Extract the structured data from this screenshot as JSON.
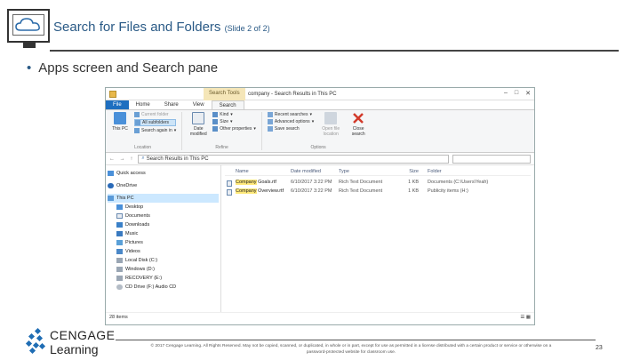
{
  "slide": {
    "title": "Search for Files and Folders",
    "subtitle": "(Slide 2 of 2)",
    "bullet": "Apps screen and Search pane",
    "page_number": "23",
    "copyright_line1": "© 2017 Cengage Learning. All Rights Reserved. May not be copied, scanned, or duplicated, in whole or in part, except for use as permitted in a license distributed with a certain product or service or otherwise on a",
    "copyright_line2": "password-protected website for classroom use.",
    "brand": "CENGAGE",
    "brand_sub": "Learning"
  },
  "window": {
    "context_tab": "Search Tools",
    "title": "company - Search Results in This PC",
    "controls": [
      "–",
      "□",
      "✕"
    ],
    "tabs": [
      "File",
      "Home",
      "Share",
      "View",
      "Search"
    ],
    "ribbon": {
      "location": {
        "label": "Location",
        "this_pc": "This PC",
        "current_folder": "Current folder",
        "all_subfolders": "All subfolders",
        "search_again": "Search again in"
      },
      "refine": {
        "label": "Refine",
        "date_modified": "Date modified",
        "kind": "Kind",
        "size": "Size",
        "other_properties": "Other properties"
      },
      "options": {
        "label": "Options",
        "recent_searches": "Recent searches",
        "advanced_options": "Advanced options",
        "save_search": "Save search",
        "open_file_location": "Open file location",
        "close_search": "Close search"
      }
    },
    "address": "Search Results in This PC",
    "nav": {
      "quick_access": "Quick access",
      "onedrive": "OneDrive",
      "this_pc": "This PC",
      "desktop": "Desktop",
      "documents": "Documents",
      "downloads": "Downloads",
      "music": "Music",
      "pictures": "Pictures",
      "videos": "Videos",
      "local_disk": "Local Disk (C:)",
      "windows": "Windows (D:)",
      "recovery": "RECOVERY (E:)",
      "cd_drive": "CD Drive (F:) Audio CD"
    },
    "columns": {
      "name": "Name",
      "date": "Date modified",
      "type": "Type",
      "size": "Size",
      "folder": "Folder"
    },
    "files": [
      {
        "prefix": "Company",
        "rest": " Goals.rtf",
        "date": "6/10/2017 3:22 PM",
        "type": "Rich Text Document",
        "size": "1 KB",
        "folder": "Documents (C:\\Users\\Yeah)"
      },
      {
        "prefix": "Company",
        "rest": " Overview.rtf",
        "date": "6/10/2017 3:22 PM",
        "type": "Rich Text Document",
        "size": "1 KB",
        "folder": "Publicity items (H:)"
      }
    ],
    "status": "28 items",
    "view_icons": "☰ ▦"
  }
}
